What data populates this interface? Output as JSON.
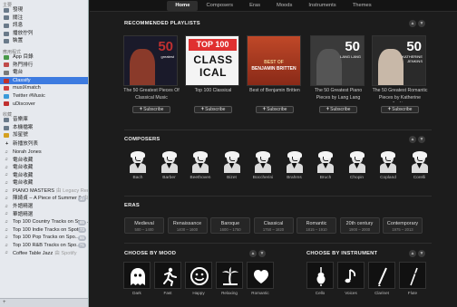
{
  "sidebar": {
    "header_library": "主要",
    "library": [
      {
        "label": "發現",
        "icon": "compass-icon",
        "color": "#6a7a8a"
      },
      {
        "label": "關注",
        "icon": "people-icon",
        "color": "#6a7a8a"
      },
      {
        "label": "訊息",
        "icon": "inbox-icon",
        "color": "#6a7a8a"
      },
      {
        "label": "播放佇列",
        "icon": "queue-icon",
        "color": "#6a7a8a"
      },
      {
        "label": "裝置",
        "icon": "device-icon",
        "color": "#6a7a8a"
      }
    ],
    "header_apps": "應用程式",
    "apps": [
      {
        "label": "App 目錄",
        "icon": "app-finder-icon",
        "color": "#4a9a4a"
      },
      {
        "label": "熱門排行",
        "icon": "top-lists-icon",
        "color": "#c04a4a"
      },
      {
        "label": "電台",
        "icon": "radio-icon",
        "color": "#7a7a7a"
      },
      {
        "label": "Classify",
        "icon": "classify-icon",
        "color": "#c0302a",
        "selected": true
      },
      {
        "label": "musiXmatch",
        "icon": "musixmatch-icon",
        "color": "#d04040"
      },
      {
        "label": "Twitter #Music",
        "icon": "twitter-icon",
        "color": "#3a9ad9"
      },
      {
        "label": "uDiscover",
        "icon": "udiscover-icon",
        "color": "#c03030"
      }
    ],
    "header_collection": "收藏",
    "collection": [
      {
        "label": "音樂庫",
        "icon": "music-library-icon",
        "color": "#6a7a8a"
      },
      {
        "label": "本機檔案",
        "icon": "local-files-icon",
        "color": "#6a7a8a"
      },
      {
        "label": "加星號",
        "icon": "star-icon",
        "color": "#d4a020"
      }
    ],
    "new_playlist": "新播放列表",
    "playlists": [
      {
        "label": "Norah Jones",
        "count": ""
      },
      {
        "label": "電台收藏",
        "count": ""
      },
      {
        "label": "電台收藏",
        "count": ""
      },
      {
        "label": "電台收藏",
        "count": ""
      },
      {
        "label": "電台收藏",
        "count": ""
      },
      {
        "label": "PIANO MASTERS",
        "suffix": "由 Legacy Reco...",
        "count": ""
      },
      {
        "label": "陳綺貞 – A Piece of Summer II",
        "suffix": "由 ...",
        "count": "10"
      },
      {
        "label": "外語精選",
        "count": ""
      },
      {
        "label": "華語精選",
        "count": ""
      },
      {
        "label": "Top 100 Country Tracks on Spo...",
        "count": "65"
      },
      {
        "label": "Top 100 Indie Tracks on Spotify",
        "count": "73"
      },
      {
        "label": "Top 100 Pop Tracks on Spo...",
        "count": "65"
      },
      {
        "label": "Top 100 R&B Tracks on Spo...",
        "count": "71"
      },
      {
        "label": "Coffee Table Jazz",
        "suffix": "由 Spotify",
        "count": ""
      }
    ]
  },
  "tabs": [
    {
      "label": "Home",
      "active": true
    },
    {
      "label": "Composers"
    },
    {
      "label": "Eras"
    },
    {
      "label": "Moods"
    },
    {
      "label": "Instruments"
    },
    {
      "label": "Themes"
    }
  ],
  "sections": {
    "recommended": "RECOMMENDED PLAYLISTS",
    "composers": "COMPOSERS",
    "eras": "ERAS",
    "mood": "CHOOSE BY MOOD",
    "instrument": "CHOOSE BY INSTRUMENT"
  },
  "subscribe_label": "Subscribe",
  "playlists": [
    {
      "title": "The 50 Greatest Pieces Of Classical Music",
      "cover": {
        "bg": "#1a1a2a",
        "accent": "#c03030",
        "text": "50",
        "sub": "greatest"
      }
    },
    {
      "title": "Top 100 Classical",
      "cover": {
        "bg": "#f4f4f4",
        "accent": "#e03030",
        "text": "TOP 100",
        "sub": "CLASS ICAL"
      }
    },
    {
      "title": "Best of Benjamin Britten",
      "cover": {
        "bg": "#b04020",
        "accent": "#e8c080",
        "text": "BEST OF",
        "sub": "BENJAMIN BRITTEN"
      }
    },
    {
      "title": "The 50 Greatest Piano Pieces by Lang Lang",
      "cover": {
        "bg": "#3a3a3a",
        "accent": "#ffffff",
        "text": "50",
        "sub": "LANG LANG"
      }
    },
    {
      "title": "The 50 Greatest Romantic Pieces by Katherine Jenkins",
      "cover": {
        "bg": "#2a2a2a",
        "accent": "#ffffff",
        "text": "50",
        "sub": "KATHERINE JENKINS"
      }
    }
  ],
  "composers": [
    "Bach",
    "Barber",
    "Beethoven",
    "Bizet",
    "Boccherini",
    "Brahms",
    "Bruch",
    "Chopin",
    "Copland",
    "Corelli"
  ],
  "eras": [
    {
      "name": "Medieval",
      "years": "500 – 1400"
    },
    {
      "name": "Renaissance",
      "years": "1400 – 1600"
    },
    {
      "name": "Baroque",
      "years": "1600 – 1750"
    },
    {
      "name": "Classical",
      "years": "1750 – 1820"
    },
    {
      "name": "Romantic",
      "years": "1815 – 1910"
    },
    {
      "name": "20th century",
      "years": "1900 – 2000"
    },
    {
      "name": "Contemporary",
      "years": "1975 – 2013"
    }
  ],
  "moods": [
    {
      "label": "Dark",
      "icon": "ghost-icon"
    },
    {
      "label": "Fast",
      "icon": "runner-icon"
    },
    {
      "label": "Happy",
      "icon": "smiley-icon"
    },
    {
      "label": "Relaxing",
      "icon": "palm-tree-icon"
    },
    {
      "label": "Romantic",
      "icon": "heart-icon"
    }
  ],
  "instruments": [
    {
      "label": "Cello",
      "icon": "cello-icon"
    },
    {
      "label": "Voices",
      "icon": "music-note-icon"
    },
    {
      "label": "Clarinet",
      "icon": "clarinet-icon"
    },
    {
      "label": "Flute",
      "icon": "flute-icon"
    }
  ]
}
